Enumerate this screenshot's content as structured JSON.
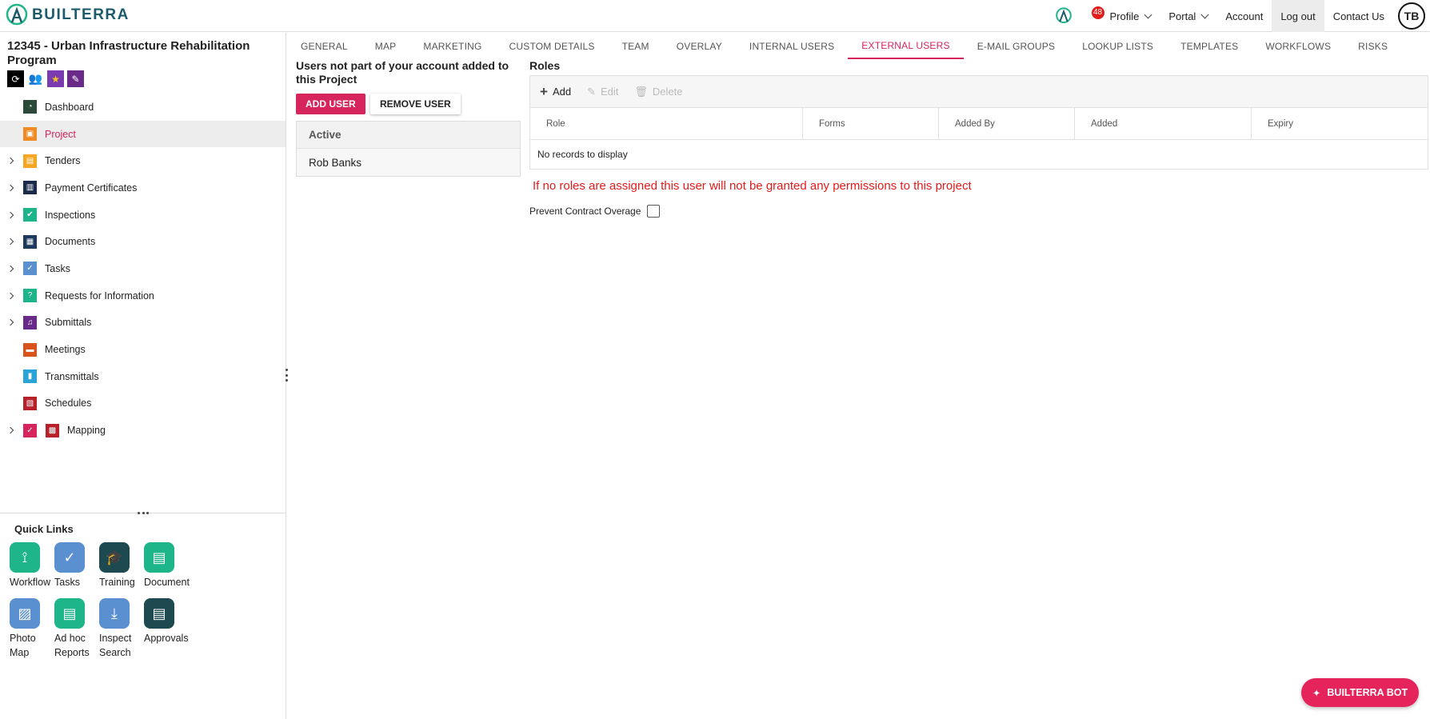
{
  "app": {
    "logo_text": "BUILTERRA"
  },
  "topnav": {
    "notifications_count": "48",
    "profile": "Profile",
    "portal": "Portal",
    "account": "Account",
    "logout": "Log out",
    "contact": "Contact Us",
    "avatar_initials": "TB"
  },
  "project": {
    "title": "12345 - Urban Infrastructure Rehabilitation Program"
  },
  "sidebar": {
    "items": [
      {
        "label": "Dashboard",
        "expandable": false,
        "color": "#2b4a3a"
      },
      {
        "label": "Project",
        "expandable": false,
        "color": "#f08a24",
        "selected": true
      },
      {
        "label": "Tenders",
        "expandable": true,
        "color": "#f5a623"
      },
      {
        "label": "Payment Certificates",
        "expandable": true,
        "color": "#1b2a4a"
      },
      {
        "label": "Inspections",
        "expandable": true,
        "color": "#1fb58a"
      },
      {
        "label": "Documents",
        "expandable": true,
        "color": "#1d3a5c"
      },
      {
        "label": "Tasks",
        "expandable": true,
        "color": "#5a8fd0"
      },
      {
        "label": "Requests for Information",
        "expandable": true,
        "color": "#1fb58a"
      },
      {
        "label": "Submittals",
        "expandable": true,
        "color": "#6a2a8a"
      },
      {
        "label": "Meetings",
        "expandable": false,
        "color": "#d9531e"
      },
      {
        "label": "Transmittals",
        "expandable": false,
        "color": "#2aa3d6"
      },
      {
        "label": "Schedules",
        "expandable": false,
        "color": "#b8202a"
      },
      {
        "label": "Mapping",
        "expandable": true,
        "color": "#b8202a"
      }
    ]
  },
  "quick_links": {
    "title": "Quick Links",
    "items": [
      {
        "label": "Workflow",
        "color": "#1fb58a"
      },
      {
        "label": "Tasks",
        "color": "#5a8fd0"
      },
      {
        "label": "Training",
        "color": "#1d4a50"
      },
      {
        "label": "Document",
        "color": "#1fb58a"
      },
      {
        "label": "Photo Map",
        "color": "#5a8fd0"
      },
      {
        "label": "Ad hoc Reports",
        "color": "#1fb58a"
      },
      {
        "label": "Inspect Search",
        "color": "#5a8fd0"
      },
      {
        "label": "Approvals",
        "color": "#1d4a50"
      }
    ]
  },
  "tabs": [
    "GENERAL",
    "MAP",
    "MARKETING",
    "CUSTOM DETAILS",
    "TEAM",
    "OVERLAY",
    "INTERNAL USERS",
    "EXTERNAL USERS",
    "E-MAIL GROUPS",
    "LOOKUP LISTS",
    "TEMPLATES",
    "WORKFLOWS",
    "RISKS"
  ],
  "active_tab": "EXTERNAL USERS",
  "external_users": {
    "title": "Users not part of your account added to this Project",
    "add_user": "ADD USER",
    "remove_user": "REMOVE USER",
    "list_header": "Active",
    "users": [
      "Rob Banks"
    ]
  },
  "roles": {
    "title": "Roles",
    "toolbar": {
      "add": "Add",
      "edit": "Edit",
      "delete": "Delete"
    },
    "columns": [
      "Role",
      "Forms",
      "Added By",
      "Added",
      "Expiry"
    ],
    "empty_text": "No records to display",
    "warning": "If no roles are assigned this user will not be granted any permissions to this project",
    "prevent_label": "Prevent Contract Overage"
  },
  "bot": {
    "label": "BUILTERRA BOT"
  },
  "colors": {
    "accent": "#d6245c",
    "warning": "#e31b1b",
    "brand": "#1d5a6b"
  }
}
